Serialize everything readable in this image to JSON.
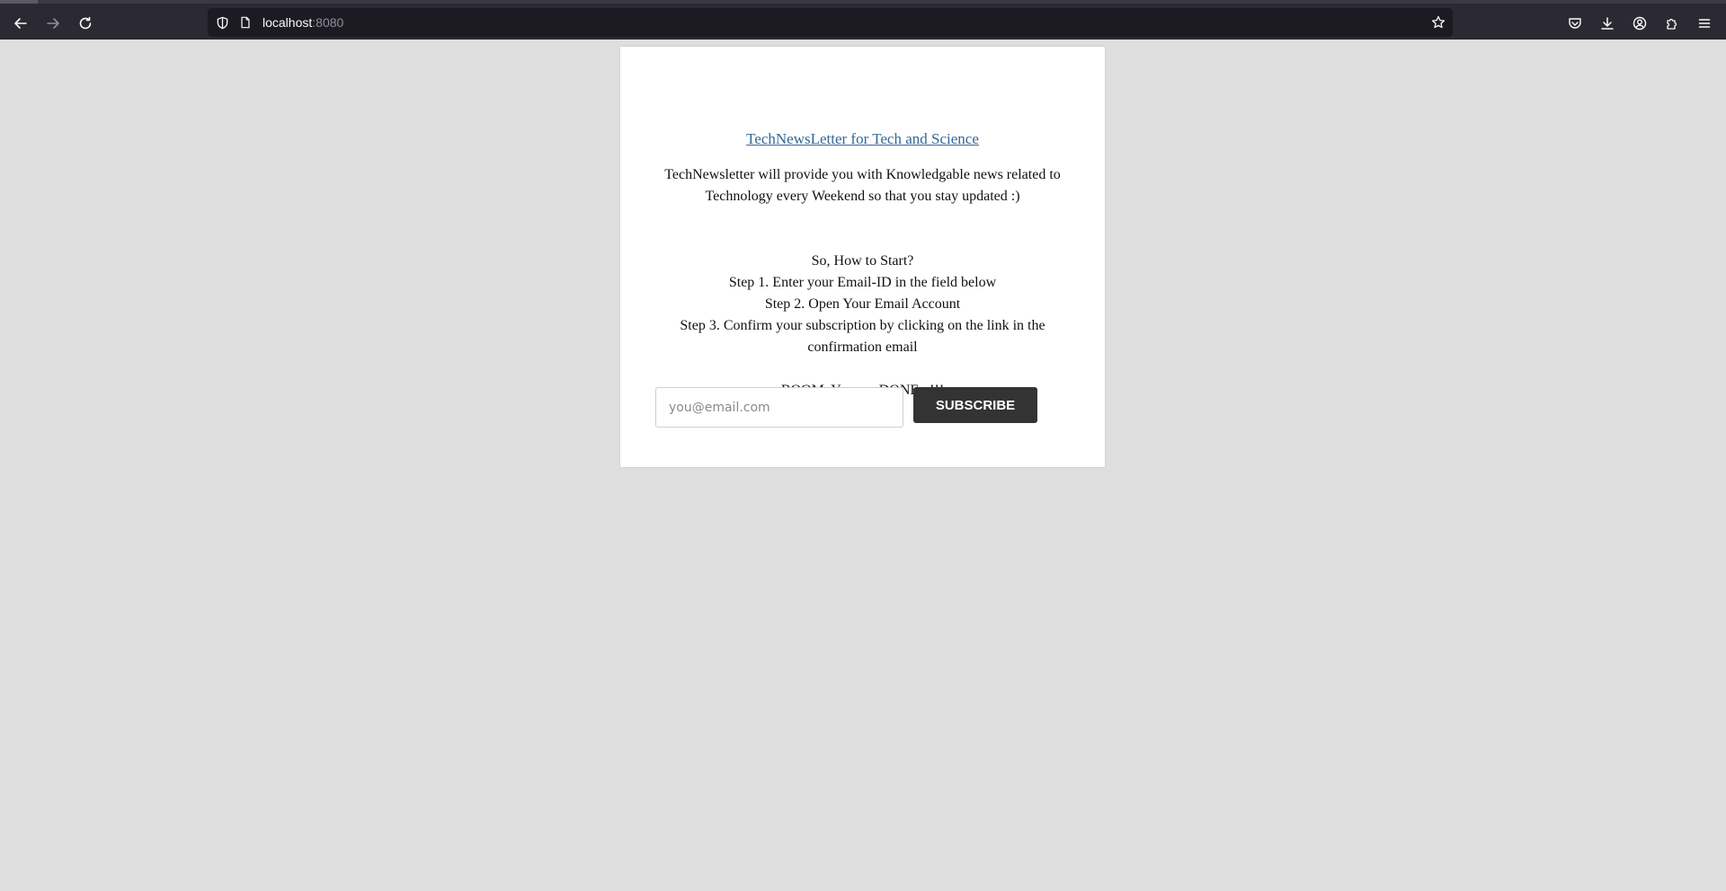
{
  "browser": {
    "url_host": "localhost",
    "url_port": ":8080"
  },
  "page": {
    "title_link": "TechNewsLetter for Tech and Science",
    "intro": "TechNewsletter will provide you with Knowledgable news related to Technology every Weekend so that you stay updated :)",
    "steps": [
      "So, How to Start?",
      "Step 1. Enter your Email-ID in the field below",
      "Step 2. Open Your Email Account",
      "Step 3. Confirm your subscription by clicking on the link in the confirmation email"
    ],
    "done_text": "BOOM, You are DONE...!!!",
    "email_placeholder": "you@email.com",
    "email_value": "",
    "subscribe_label": "SUBSCRIBE"
  },
  "colors": {
    "page_bg": "#dedede",
    "link": "#336699",
    "button_bg": "#333333",
    "chrome_bg": "#2b2a33"
  },
  "icons": {
    "back": "arrow-left-icon",
    "forward": "arrow-right-icon",
    "reload": "reload-icon",
    "tracking": "shield-icon",
    "page": "page-icon",
    "bookmark": "star-icon",
    "pocket": "pocket-icon",
    "downloads": "download-icon",
    "account": "account-icon",
    "extensions": "puzzle-icon",
    "menu": "hamburger-menu-icon"
  }
}
